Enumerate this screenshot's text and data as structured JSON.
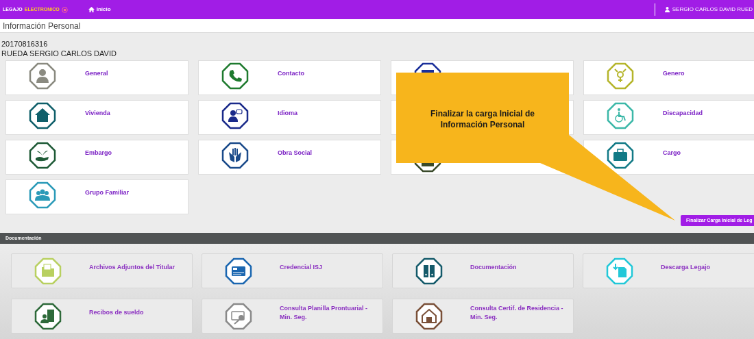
{
  "navbar": {
    "brand_parts": [
      "LEGAJO",
      "ELECTRONICO"
    ],
    "home_link": "Inicio",
    "user": "SERGIO CARLOS DAVID RUED"
  },
  "page_title": "Información Personal",
  "person": {
    "id": "20170816316",
    "name": "RUEDA SERGIO CARLOS DAVID"
  },
  "personal_modules": [
    {
      "kind": "module",
      "label": "General",
      "color": "#8a8a80"
    },
    {
      "kind": "module",
      "label": "Contacto",
      "color": "#1e7a2e"
    },
    {
      "kind": "covered",
      "color": "#1a2f9a"
    },
    {
      "kind": "module",
      "label": "Genero",
      "color": "#b5b52a"
    },
    {
      "kind": "module",
      "label": "Vivienda",
      "color": "#0f5f6a"
    },
    {
      "kind": "module",
      "label": "Idioma",
      "color": "#1a2a8a"
    },
    {
      "kind": "covered"
    },
    {
      "kind": "module",
      "label": "Discapacidad",
      "color": "#3cb8a8"
    },
    {
      "kind": "module",
      "label": "Embargo",
      "color": "#1e5a36"
    },
    {
      "kind": "module",
      "label": "Obra Social",
      "color": "#1a4a8a"
    },
    {
      "kind": "covered",
      "color": "#3a4a2a"
    },
    {
      "kind": "module",
      "label": "Cargo",
      "color": "#127a86"
    },
    {
      "kind": "module",
      "label": "Grupo Familiar",
      "color": "#2a9ab8"
    }
  ],
  "callout": {
    "text": "Finalizar la carga Inicial de Información Personal"
  },
  "finish_button": "Finalizar Carga Inicial de Leg",
  "documentation": {
    "title": "Documentación",
    "modules": [
      {
        "label": "Archivos Adjuntos del Titular",
        "color": "#b8d060"
      },
      {
        "label": "Credencial ISJ",
        "color": "#1a66b0"
      },
      {
        "label": "Documentación",
        "color": "#145a6a"
      },
      {
        "label": "Descarga Legajo",
        "color": "#22c8d8"
      },
      {
        "label": "Recibos de sueldo",
        "color": "#2e6a3a"
      },
      {
        "label": "Consulta Planilla Prontuarial - Min. Seg.",
        "color": "#8a8a8a"
      },
      {
        "label": "Consulta Certif. de Residencia - Min. Seg.",
        "color": "#7a5038"
      }
    ]
  }
}
